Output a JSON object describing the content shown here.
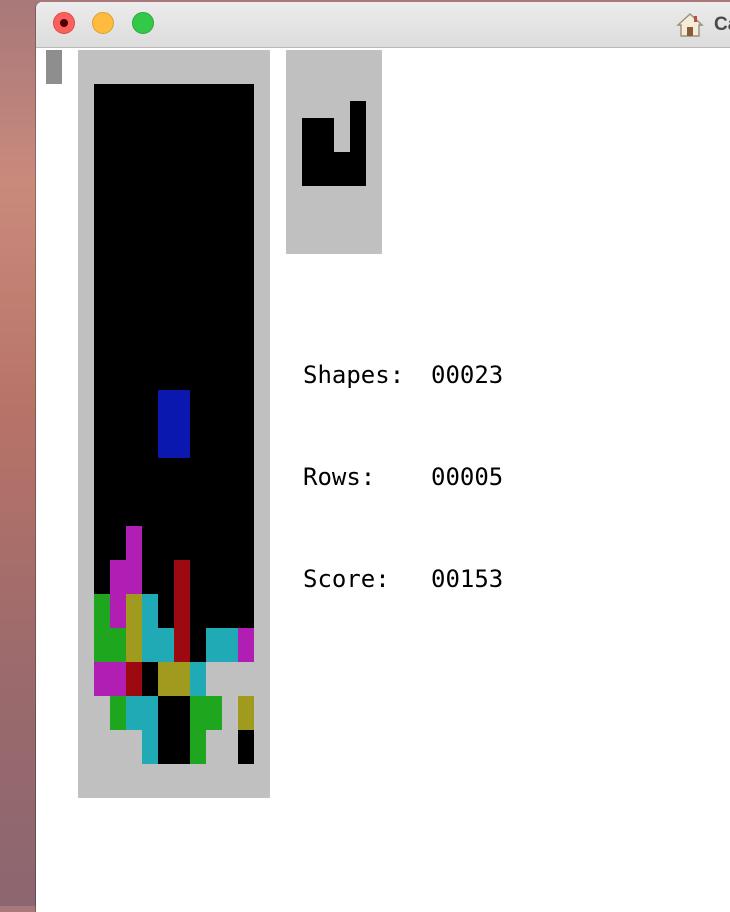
{
  "window": {
    "title": "Ca"
  },
  "colors": {
    "board_bg": "#000000",
    "frame": "#c0c0c0",
    "empty_filled": "#c0c0c0",
    "cyan": "#1faab6",
    "magenta": "#b01eb4",
    "green": "#1ea61e",
    "olive": "#a09a1e",
    "red": "#9c0a10",
    "blue": "#0a18b0"
  },
  "board": {
    "columns": 10,
    "rows": 20,
    "falling_piece": {
      "color": "blue",
      "cells": [
        [
          4,
          9
        ],
        [
          5,
          9
        ],
        [
          4,
          10
        ],
        [
          5,
          10
        ]
      ]
    },
    "locked_cells": [
      {
        "c": 2,
        "r": 13,
        "color": "magenta"
      },
      {
        "c": 1,
        "r": 14,
        "color": "magenta"
      },
      {
        "c": 2,
        "r": 14,
        "color": "magenta"
      },
      {
        "c": 5,
        "r": 14,
        "color": "red"
      },
      {
        "c": 0,
        "r": 15,
        "color": "green"
      },
      {
        "c": 1,
        "r": 15,
        "color": "magenta"
      },
      {
        "c": 2,
        "r": 15,
        "color": "olive"
      },
      {
        "c": 3,
        "r": 15,
        "color": "cyan"
      },
      {
        "c": 5,
        "r": 15,
        "color": "red"
      },
      {
        "c": 0,
        "r": 16,
        "color": "green"
      },
      {
        "c": 1,
        "r": 16,
        "color": "green"
      },
      {
        "c": 2,
        "r": 16,
        "color": "olive"
      },
      {
        "c": 3,
        "r": 16,
        "color": "cyan"
      },
      {
        "c": 4,
        "r": 16,
        "color": "cyan"
      },
      {
        "c": 5,
        "r": 16,
        "color": "red"
      },
      {
        "c": 7,
        "r": 16,
        "color": "cyan"
      },
      {
        "c": 8,
        "r": 16,
        "color": "cyan"
      },
      {
        "c": 9,
        "r": 16,
        "color": "magenta"
      },
      {
        "c": 0,
        "r": 17,
        "color": "magenta"
      },
      {
        "c": 1,
        "r": 17,
        "color": "magenta"
      },
      {
        "c": 2,
        "r": 17,
        "color": "red"
      },
      {
        "c": 4,
        "r": 17,
        "color": "olive"
      },
      {
        "c": 5,
        "r": 17,
        "color": "olive"
      },
      {
        "c": 6,
        "r": 17,
        "color": "cyan"
      },
      {
        "c": 7,
        "r": 17,
        "color": "empty_filled"
      },
      {
        "c": 8,
        "r": 17,
        "color": "empty_filled"
      },
      {
        "c": 9,
        "r": 17,
        "color": "empty_filled"
      },
      {
        "c": 0,
        "r": 18,
        "color": "empty_filled"
      },
      {
        "c": 1,
        "r": 18,
        "color": "green"
      },
      {
        "c": 2,
        "r": 18,
        "color": "cyan"
      },
      {
        "c": 3,
        "r": 18,
        "color": "cyan"
      },
      {
        "c": 6,
        "r": 18,
        "color": "green"
      },
      {
        "c": 7,
        "r": 18,
        "color": "green"
      },
      {
        "c": 8,
        "r": 18,
        "color": "empty_filled"
      },
      {
        "c": 9,
        "r": 18,
        "color": "olive"
      },
      {
        "c": 0,
        "r": 19,
        "color": "empty_filled"
      },
      {
        "c": 1,
        "r": 19,
        "color": "empty_filled"
      },
      {
        "c": 2,
        "r": 19,
        "color": "empty_filled"
      },
      {
        "c": 3,
        "r": 19,
        "color": "cyan"
      },
      {
        "c": 6,
        "r": 19,
        "color": "green"
      },
      {
        "c": 7,
        "r": 19,
        "color": "empty_filled"
      },
      {
        "c": 8,
        "r": 19,
        "color": "empty_filled"
      }
    ]
  },
  "next_piece": {
    "columns": 4,
    "rows": 8,
    "black_cells": [
      [
        3,
        1
      ],
      [
        3,
        2
      ],
      [
        3,
        3
      ],
      [
        0,
        2
      ],
      [
        1,
        2
      ],
      [
        0,
        3
      ],
      [
        1,
        3
      ],
      [
        0,
        4
      ],
      [
        1,
        4
      ],
      [
        2,
        4
      ],
      [
        3,
        4
      ],
      [
        0,
        5
      ],
      [
        1,
        5
      ],
      [
        2,
        5
      ],
      [
        3,
        5
      ]
    ]
  },
  "stats": [
    {
      "label": "Shapes:",
      "value": "00023"
    },
    {
      "label": "Rows:",
      "value": "00005"
    },
    {
      "label": "Score:",
      "value": "00153"
    }
  ]
}
